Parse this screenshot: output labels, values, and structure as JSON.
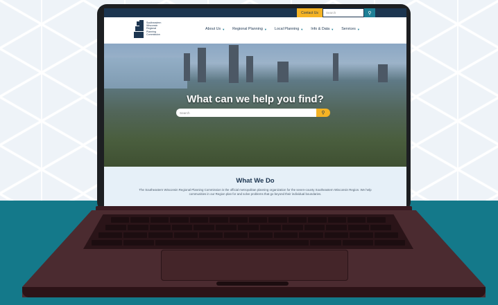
{
  "topbar": {
    "contact_label": "Contact Us",
    "search_placeholder": "Search",
    "search_icon": "search-icon"
  },
  "logo": {
    "lines": [
      "Southeastern",
      "Wisconsin",
      "Regional",
      "Planning",
      "Commission"
    ]
  },
  "nav": {
    "items": [
      {
        "label": "About Us"
      },
      {
        "label": "Regional Planning"
      },
      {
        "label": "Local Planning"
      },
      {
        "label": "Info & Data"
      },
      {
        "label": "Services"
      }
    ]
  },
  "hero": {
    "title": "What can we help you find?",
    "search_placeholder": "Search",
    "search_icon": "search-icon"
  },
  "what_we_do": {
    "title": "What We Do",
    "body": "The Southeastern Wisconsin Regional Planning Commission is the official metropolitan planning organization for the seven-county Southeastern Wisconsin Region. We help communities in our Region plan for and solve problems that go beyond their individual boundaries."
  },
  "colors": {
    "navy": "#1c3550",
    "accent_gold": "#f5b324",
    "teal": "#1e7f96",
    "background_teal": "#14798a",
    "laptop_body": "#4b2b30"
  }
}
